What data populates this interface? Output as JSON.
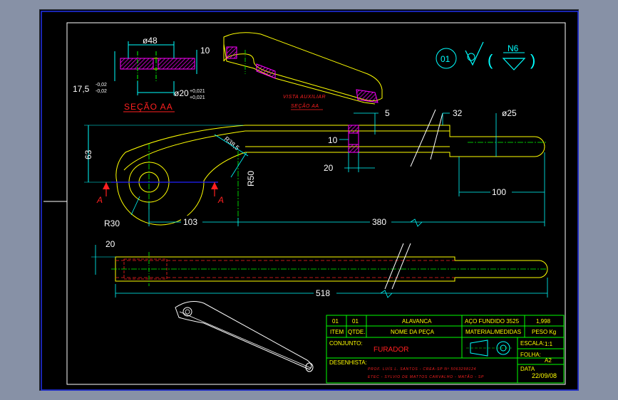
{
  "view": {
    "background": "#000000",
    "outer_frame_color": "#2233ee"
  },
  "colors": {
    "border": "#ffffff",
    "outline": "#ffff00",
    "dimension": "#00ffff",
    "center": "#00ff00",
    "section_line": "#2222ff",
    "arrow": "#ff2020",
    "hatch": "#ff00ff",
    "title_block": "#00ff00",
    "title_text": "#ffff00"
  },
  "drawing": {
    "part_number": "01",
    "surface_finish": "N6",
    "section_aa": {
      "title": "SEÇÃO AA",
      "dim_top": "ø48",
      "dim_right": "10",
      "dim_left_value": "17,5",
      "dim_left_tol_top": "-0,02",
      "dim_left_tol_bottom": "-0,02",
      "dim_bore": "ø20",
      "dim_bore_tol_top": "+0,021",
      "dim_bore_tol_bottom": "+0,021"
    },
    "aux_view": {
      "line1": "VISTA AUXILIAR",
      "line2": "SEÇÃO AA"
    },
    "front_view": {
      "dim_5": "5",
      "dim_32": "32",
      "dim_phi25": "ø25",
      "dim_63": "63",
      "dim_r38": "R38,5",
      "dim_r50": "R50",
      "dim_10": "10",
      "dim_20": "20",
      "dim_100": "100",
      "dim_r30": "R30",
      "dim_103": "103",
      "dim_380": "380",
      "section_mark": "A"
    },
    "top_view": {
      "dim_20": "20",
      "dim_518": "518"
    }
  },
  "title_block": {
    "row1": {
      "col1": "01",
      "col2": "01",
      "name": "ALAVANCA",
      "material": "AÇO FUNDIDO 3525",
      "weight": "1,998"
    },
    "row2": {
      "col1": "ITEM",
      "col2": "QTDE.",
      "name": "NOME DA PEÇA",
      "material": "MATERIAL/MEDIDAS",
      "weight": "PESO Kg"
    },
    "conjunto_label": "CONJUNTO:",
    "conjunto_value": "FURADOR",
    "escala_label": "ESCALA:",
    "escala_value": "1:1",
    "folha_label": "FOLHA:",
    "folha_value": "A2",
    "desenhista_label": "DESENHISTA:",
    "desenhista_line1": "PROF. LUÍS L. SANTOS - CREA-SP Nº 5063298124",
    "desenhista_line2": "ETEC - SYLVIO DE MATTOS CARVALHO - MATÃO - SP",
    "data_label": "DATA",
    "data_value": "22/09/08"
  }
}
